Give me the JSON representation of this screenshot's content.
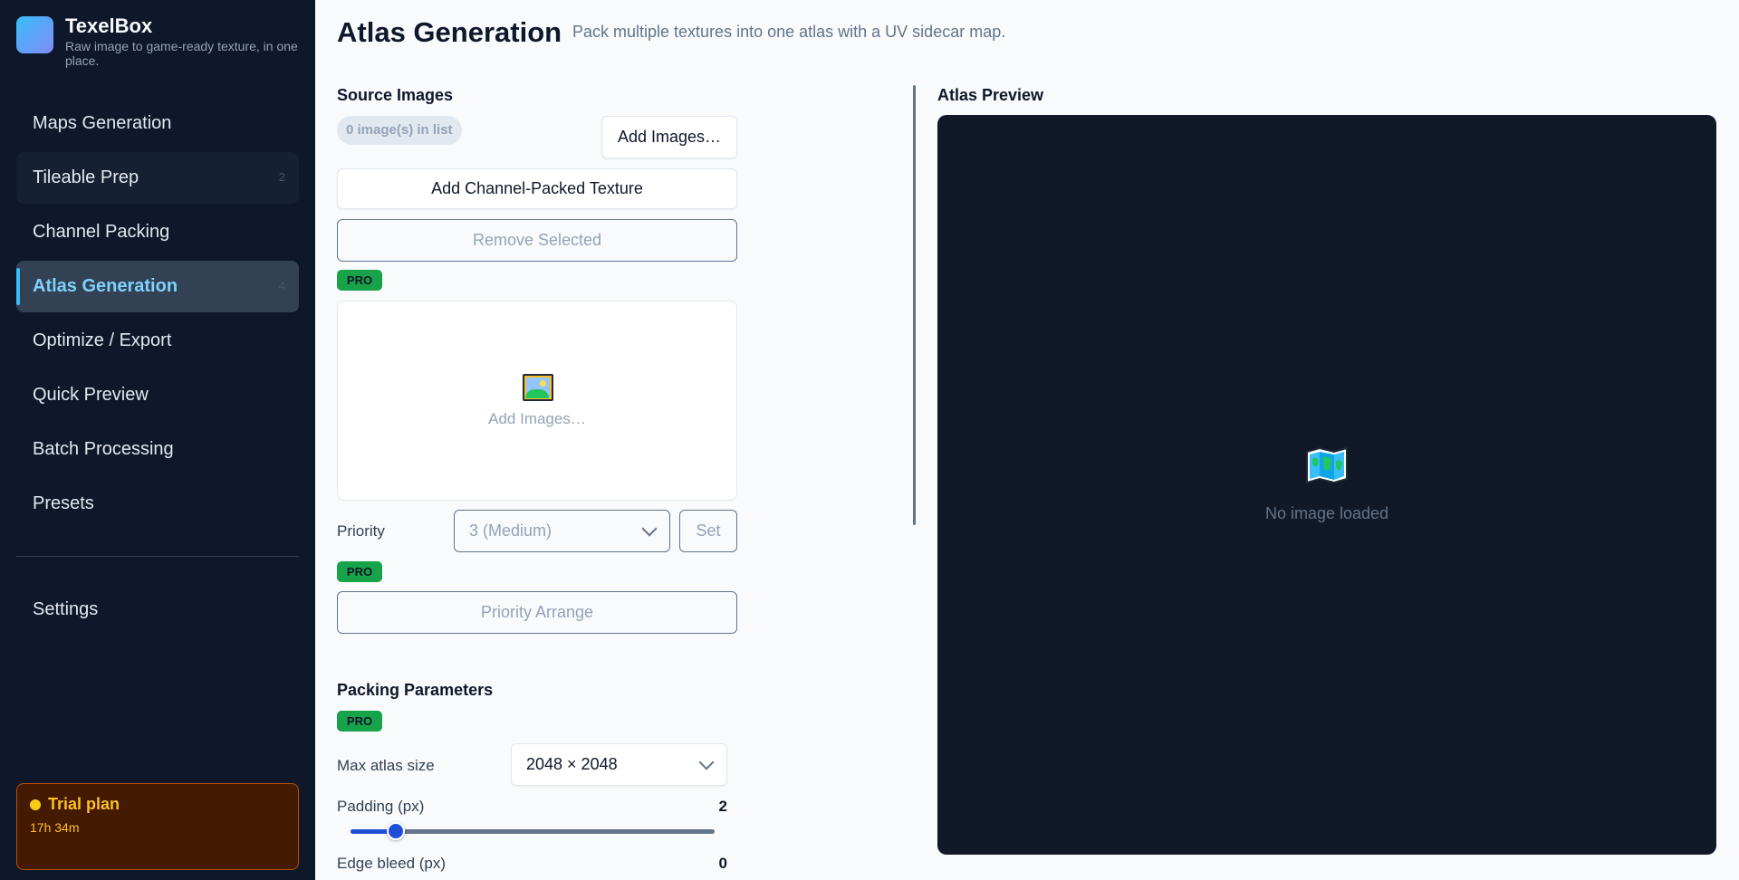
{
  "app": {
    "name": "TexelBox",
    "tagline": "Raw image to game-ready texture, in one place."
  },
  "sidebar": {
    "items": [
      {
        "label": "Maps Generation",
        "badge": ""
      },
      {
        "label": "Tileable Prep",
        "badge": "2"
      },
      {
        "label": "Channel Packing",
        "badge": ""
      },
      {
        "label": "Atlas Generation",
        "badge": "4",
        "active": true
      },
      {
        "label": "Optimize / Export",
        "badge": ""
      },
      {
        "label": "Quick Preview",
        "badge": ""
      },
      {
        "label": "Batch Processing",
        "badge": ""
      },
      {
        "label": "Presets",
        "badge": ""
      }
    ],
    "settings_label": "Settings",
    "trial": {
      "title": "Trial plan",
      "time": "17h 34m"
    }
  },
  "page": {
    "title": "Atlas Generation",
    "subtitle": "Pack multiple textures into one atlas with a UV sidecar map."
  },
  "source": {
    "title": "Source Images",
    "count": "0 image(s) in list",
    "add_images": "Add Images…",
    "add_channel_packed": "Add Channel-Packed Texture",
    "remove_selected": "Remove Selected",
    "pro_badge": "PRO",
    "drop_text": "Add Images…",
    "priority_label": "Priority",
    "priority_value": "3 (Medium)",
    "set_label": "Set",
    "priority_arrange": "Priority Arrange"
  },
  "packing": {
    "title": "Packing Parameters",
    "pro_badge": "PRO",
    "max_size_label": "Max atlas size",
    "max_size_value": "2048 × 2048",
    "padding_label": "Padding (px)",
    "padding_value": "2",
    "padding_fraction": 0.125,
    "edge_bleed_label": "Edge bleed (px)",
    "edge_bleed_value": "0"
  },
  "preview": {
    "title": "Atlas Preview",
    "empty_text": "No image loaded"
  },
  "colors": {
    "sidebar_bg": "#0f172a",
    "accent": "#38bdf8",
    "pro": "#16a34a",
    "trial_bg": "#451a03"
  }
}
